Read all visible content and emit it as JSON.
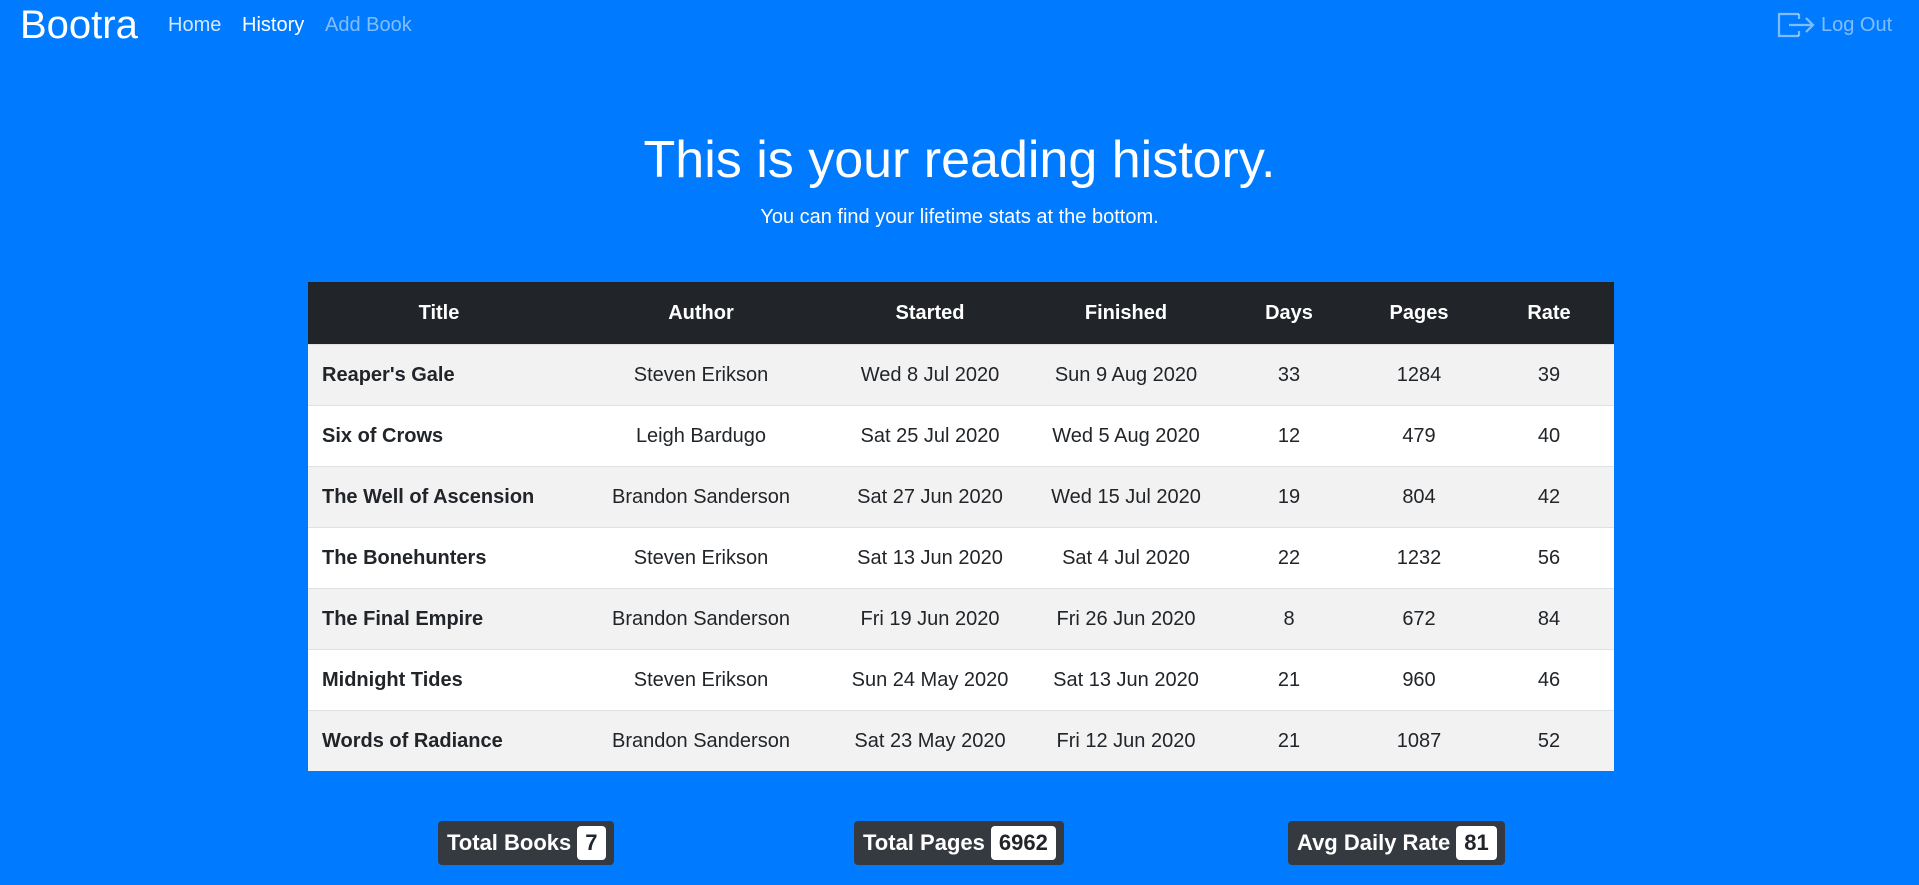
{
  "nav": {
    "brand": "Bootra",
    "links": [
      "Home",
      "History",
      "Add Book"
    ],
    "logout_label": "Log Out",
    "logout_icon": "box-arrow-right-icon"
  },
  "header": {
    "title": "This is your reading history.",
    "subtitle": "You can find your lifetime stats at the bottom."
  },
  "table": {
    "columns": [
      "Title",
      "Author",
      "Started",
      "Finished",
      "Days",
      "Pages",
      "Rate"
    ],
    "rows": [
      [
        "Reaper's Gale",
        "Steven Erikson",
        "Wed 8 Jul 2020",
        "Sun 9 Aug 2020",
        "33",
        "1284",
        "39"
      ],
      [
        "Six of Crows",
        "Leigh Bardugo",
        "Sat 25 Jul 2020",
        "Wed 5 Aug 2020",
        "12",
        "479",
        "40"
      ],
      [
        "The Well of Ascension",
        "Brandon Sanderson",
        "Sat 27 Jun 2020",
        "Wed 15 Jul 2020",
        "19",
        "804",
        "42"
      ],
      [
        "The Bonehunters",
        "Steven Erikson",
        "Sat 13 Jun 2020",
        "Sat 4 Jul 2020",
        "22",
        "1232",
        "56"
      ],
      [
        "The Final Empire",
        "Brandon Sanderson",
        "Fri 19 Jun 2020",
        "Fri 26 Jun 2020",
        "8",
        "672",
        "84"
      ],
      [
        "Midnight Tides",
        "Steven Erikson",
        "Sun 24 May 2020",
        "Sat 13 Jun 2020",
        "21",
        "960",
        "46"
      ],
      [
        "Words of Radiance",
        "Brandon Sanderson",
        "Sat 23 May 2020",
        "Fri 12 Jun 2020",
        "21",
        "1087",
        "52"
      ]
    ]
  },
  "stats": {
    "total_books_label": "Total Books",
    "total_books": "7",
    "total_pages_label": "Total Pages",
    "total_pages": "6962",
    "avg_rate_label": "Avg Daily Rate",
    "avg_rate": "81"
  },
  "colors": {
    "background": "#007bff",
    "table_header": "#212529",
    "stat_badge": "#343a40"
  }
}
